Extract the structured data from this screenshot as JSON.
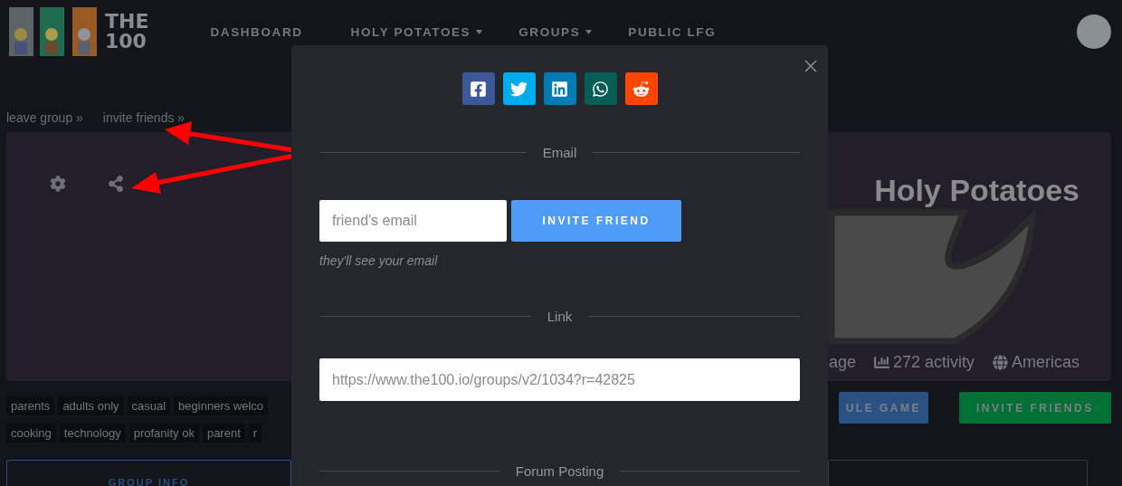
{
  "header": {
    "logo_lines": [
      "THE",
      "100"
    ],
    "nav": [
      {
        "label": "DASHBOARD",
        "dropdown": false
      },
      {
        "label": "HOLY POTATOES",
        "dropdown": true
      },
      {
        "label": "GROUPS",
        "dropdown": true
      },
      {
        "label": "PUBLIC LFG",
        "dropdown": false
      }
    ]
  },
  "group_links": [
    "leave group »",
    "invite friends »"
  ],
  "banner": {
    "title": "Holy Potatoes",
    "stats": [
      {
        "kind": "plain",
        "text": "age"
      },
      {
        "kind": "chart",
        "text": "272 activity"
      },
      {
        "kind": "globe",
        "text": "Americas"
      }
    ]
  },
  "tags": [
    [
      "parents",
      "adults only",
      "casual",
      "beginners welco"
    ],
    [
      "cooking",
      "technology",
      "profanity ok",
      "parent",
      "r"
    ]
  ],
  "buttons": [
    {
      "kind": "primary",
      "label": "ULE GAME"
    },
    {
      "kind": "success",
      "label": "INVITE FRIENDS"
    }
  ],
  "tabs": [
    {
      "label": "GROUP INFO"
    }
  ],
  "modal": {
    "share_buttons": [
      {
        "kind": "facebook"
      },
      {
        "kind": "twitter"
      },
      {
        "kind": "linkedin"
      },
      {
        "kind": "whatsapp"
      },
      {
        "kind": "reddit"
      }
    ],
    "email": {
      "heading": "Email",
      "placeholder": "friend's email",
      "button": "INVITE FRIEND",
      "note": "they'll see your email"
    },
    "link": {
      "heading": "Link",
      "value": "https://www.the100.io/groups/v2/1034?r=42825"
    },
    "forum": {
      "heading": "Forum Posting"
    }
  }
}
